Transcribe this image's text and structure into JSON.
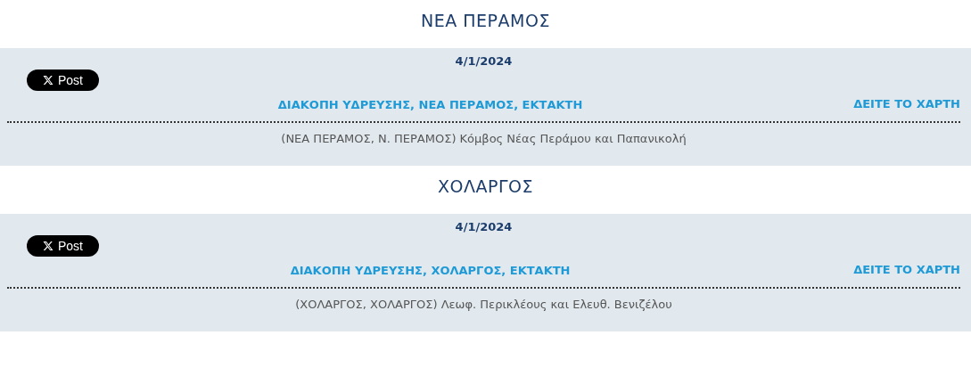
{
  "sections": [
    {
      "area": "ΝΕΑ ΠΕΡΑΜΟΣ",
      "date": "4/1/2024",
      "share_button": "Post",
      "title": "ΔΙΑΚΟΠΗ ΥΔΡΕΥΣΗΣ, ΝΕΑ ΠΕΡΑΜΟΣ, ΕΚΤΑΚΤΗ",
      "map_link": "ΔΕΙΤΕ ΤΟ ΧΑΡΤΗ",
      "description": "(ΝΕΑ ΠΕΡΑΜΟΣ, Ν. ΠΕΡΑΜΟΣ) Κόμβος Νέας Περάμου και Παπανικολή"
    },
    {
      "area": "ΧΟΛΑΡΓΟΣ",
      "date": "4/1/2024",
      "share_button": "Post",
      "title": "ΔΙΑΚΟΠΗ ΥΔΡΕΥΣΗΣ, ΧΟΛΑΡΓΟΣ, ΕΚΤΑΚΤΗ",
      "map_link": "ΔΕΙΤΕ ΤΟ ΧΑΡΤΗ",
      "description": "(ΧΟΛΑΡΓΟΣ, ΧΟΛΑΡΓΟΣ) Λεωφ. Περικλέους και Ελευθ. Βενιζέλου"
    }
  ]
}
